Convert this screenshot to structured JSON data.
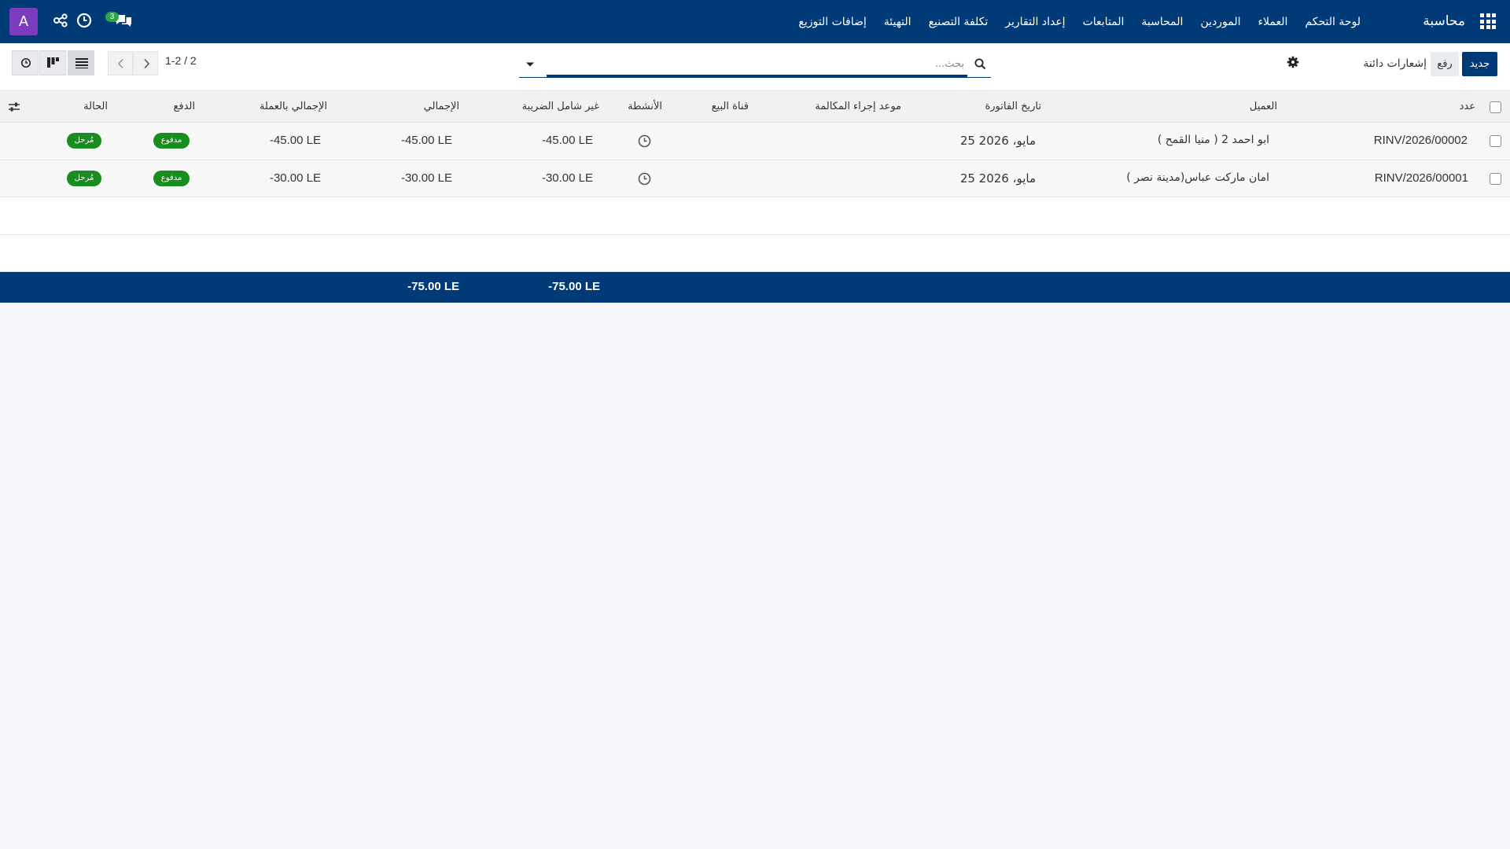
{
  "navbar": {
    "app_name": "محاسبة",
    "menu": [
      "لوحة التحكم",
      "العملاء",
      "الموردين",
      "المحاسبة",
      "المتابعات",
      "إعداد التقارير",
      "تكلفة التصنيع",
      "التهيئة",
      "إضافات التوزيع"
    ],
    "messages_count": "3",
    "avatar_letter": "A",
    "icons": [
      "apps-grid-icon",
      "chat-icon",
      "clock-icon",
      "share-icon"
    ]
  },
  "control_panel": {
    "new_label": "جديد",
    "upload_label": "رفع",
    "title": "إشعارات دائنة",
    "search_placeholder": "بحث...",
    "pager": "1-2 / 2"
  },
  "table": {
    "columns": [
      "عدد",
      "العميل",
      "تاريخ الفاتورة",
      "موعد إجراء المكالمة",
      "قناة البيع",
      "الأنشطة",
      "غير شامل الضريبة",
      "الإجمالي",
      "الإجمالي بالعملة",
      "الدفع",
      "الحالة"
    ],
    "rows": [
      {
        "number": "RINV/2026/00002",
        "customer": "ابو احمد 2 ( منيا القمح )",
        "invoice_date": "25 مايو، 2026",
        "untaxed": "-45.00 LE",
        "total": "-45.00 LE",
        "total_currency": "-45.00 LE",
        "payment": "مدفوع",
        "status": "مُرحل"
      },
      {
        "number": "RINV/2026/00001",
        "customer": "امان ماركت عباس(مدينة نصر )",
        "invoice_date": "25 مايو، 2026",
        "untaxed": "-30.00 LE",
        "total": "-30.00 LE",
        "total_currency": "-30.00 LE",
        "payment": "مدفوع",
        "status": "مُرحل"
      }
    ],
    "footer": {
      "untaxed_total": "-75.00 LE",
      "total": "-75.00 LE"
    }
  },
  "colors": {
    "primary": "#003b78",
    "avatar": "#7b3cc0",
    "badge": "#198e1e",
    "notification": "#28a745"
  }
}
